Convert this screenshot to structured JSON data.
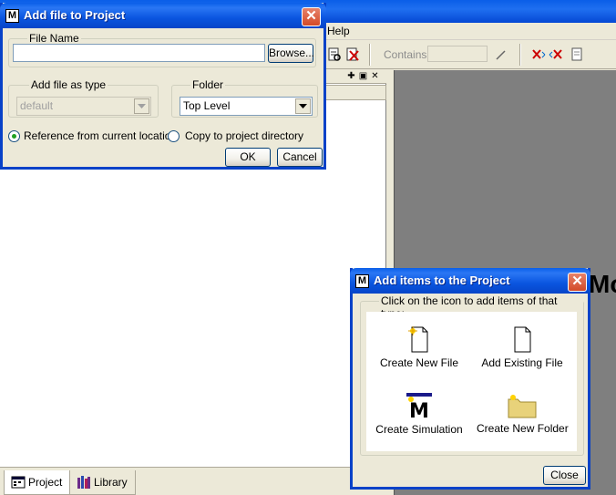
{
  "main_window": {
    "menu": [
      "Help"
    ]
  },
  "toolbar": {
    "contains_label": "Contains:"
  },
  "background": {
    "partial_text": "Mo"
  },
  "bottom_tabs": [
    {
      "label": "Project",
      "active": true
    },
    {
      "label": "Library",
      "active": false
    }
  ],
  "add_file_dialog": {
    "title": "Add file to Project",
    "file_name_group": "File Name",
    "file_name_value": "",
    "browse_label": "Browse...",
    "add_as_type_group": "Add file as type",
    "add_as_type_value": "default",
    "folder_group": "Folder",
    "folder_value": "Top Level",
    "radio_reference": "Reference from current location",
    "radio_copy": "Copy to project directory",
    "ok_label": "OK",
    "cancel_label": "Cancel"
  },
  "add_items_dialog": {
    "title": "Add items to the Project",
    "instruction": "Click on the icon to add items of that type:",
    "items": [
      {
        "label": "Create New File",
        "icon": "new-file-icon"
      },
      {
        "label": "Add Existing File",
        "icon": "existing-file-icon"
      },
      {
        "label": "Create Simulation",
        "icon": "simulation-icon"
      },
      {
        "label": "Create New Folder",
        "icon": "new-folder-icon"
      }
    ],
    "close_label": "Close"
  },
  "colors": {
    "title_blue": "#0a5ee8",
    "close_red": "#d34a28",
    "dialog_bg": "#ece9d8",
    "gray_canvas": "#7f7f7f"
  }
}
